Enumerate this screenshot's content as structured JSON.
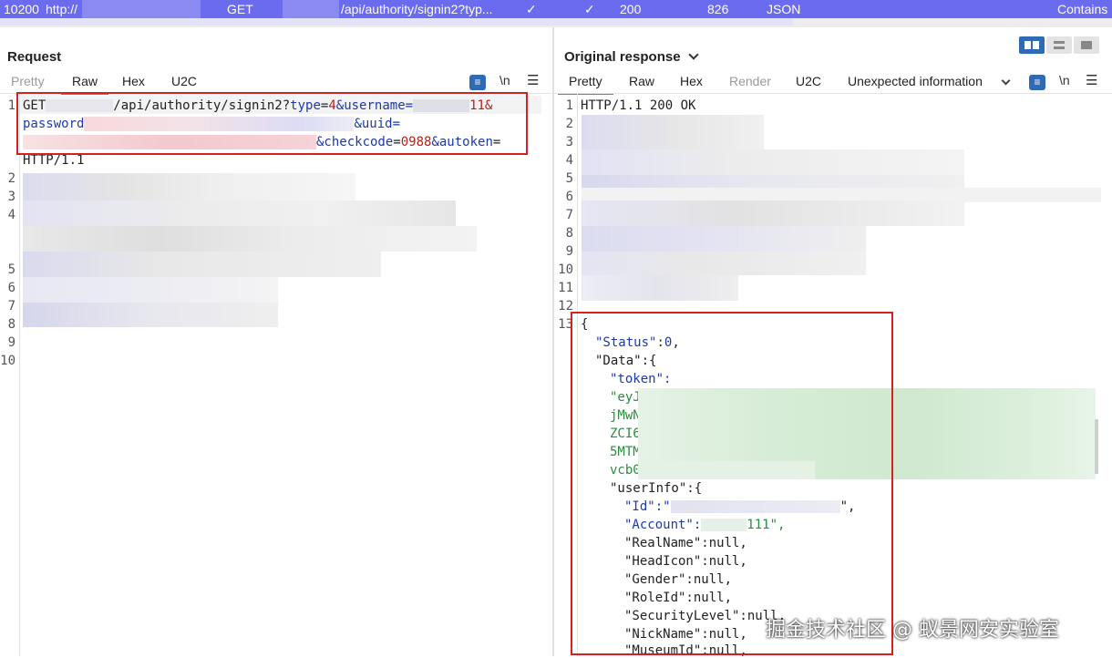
{
  "toprow": {
    "id": "10200",
    "protocol": "http://",
    "method": "GET",
    "url": "/api/authority/signin2?typ...",
    "check1": "✓",
    "check2": "✓",
    "status": "200",
    "length": "826",
    "mime": "JSON",
    "contains": "Contains"
  },
  "request": {
    "title": "Request",
    "tabs": [
      "Pretty",
      "Raw",
      "Hex",
      "U2C"
    ],
    "active_tab": "Raw",
    "newline_label": "\\n",
    "line_numbers": [
      "1",
      "2",
      "3",
      "4",
      "5",
      "6",
      "7",
      "8",
      "9",
      "10"
    ],
    "line1a_method": "GET",
    "line1a_path": "/api/authority/signin2?",
    "line1a_type_key": "type",
    "line1a_type_val": "4",
    "line1a_user_key": "&username=",
    "line1a_user_val": "11&",
    "line1b_pass_key": "password",
    "line1b_uuid_key": "&uuid=",
    "line1c_checkcode_key": "&checkcode",
    "line1c_checkcode_val": "0988",
    "line1c_autoken_key": "&autoken",
    "line1d": "HTTP/1.1",
    "eq": "="
  },
  "response": {
    "title": "Original response",
    "tabs": [
      "Pretty",
      "Raw",
      "Hex",
      "Render",
      "U2C",
      "Unexpected information"
    ],
    "active_tab": "Pretty",
    "disabled_tab": "Render",
    "newline_label": "\\n",
    "line_numbers": [
      "1",
      "2",
      "3",
      "4",
      "5",
      "6",
      "7",
      "8",
      "9",
      "10",
      "11",
      "12",
      "13"
    ],
    "status_line": "HTTP/1.1 200 OK",
    "json": {
      "open": "{",
      "status": "\"Status\":0,",
      "data": "\"Data\":{",
      "token_key": "\"token\":",
      "token_frag": [
        "\"eyJ",
        "jMwN",
        "ZCI6",
        "5MTM",
        "vcb0"
      ],
      "userinfo": "\"userInfo\":{",
      "id_key": "\"Id\":\"",
      "id_end": "\",",
      "account_key": "\"Account\":",
      "account_val": "111\",",
      "fields": [
        "\"RealName\":null,",
        "\"HeadIcon\":null,",
        "\"Gender\":null,",
        "\"RoleId\":null,",
        "\"SecurityLevel\":null,",
        "\"NickName\":null,",
        "\"MuseumId\":null,"
      ]
    }
  },
  "watermark": "掘金技术社区 @ 蚁景网安实验室",
  "colors": {
    "accent": "#6b6bef",
    "highlight_box": "#d82020",
    "tab_underline": "#e05a3a"
  }
}
